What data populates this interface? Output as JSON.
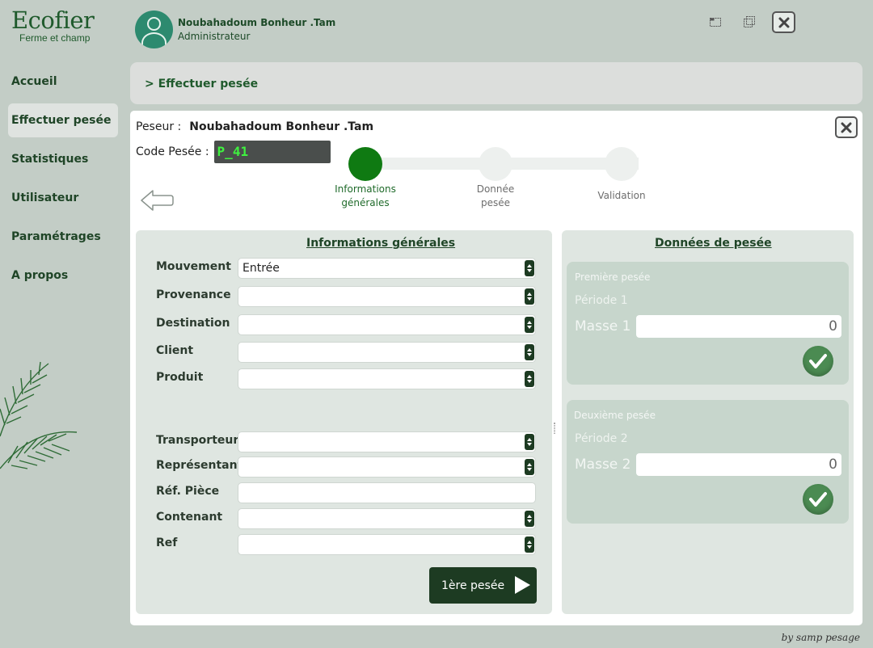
{
  "app": {
    "title": "Ecofier",
    "subtitle": "Ferme et champ"
  },
  "user": {
    "name": "Noubahadoum Bonheur .Tam",
    "role": "Administrateur"
  },
  "sidebar": {
    "items": [
      {
        "label": "Accueil"
      },
      {
        "label": "Effectuer pesée"
      },
      {
        "label": "Statistiques"
      },
      {
        "label": "Utilisateur"
      },
      {
        "label": "Paramétrages"
      },
      {
        "label": "A propos"
      }
    ]
  },
  "breadcrumb": "> Effectuer pesée",
  "session": {
    "peseur_label": "Peseur :",
    "peseur_name": "Noubahadoum Bonheur .Tam",
    "code_label": "Code Pesée :",
    "code_value": "P_41"
  },
  "stepper": {
    "steps": [
      {
        "label": "Informations générales",
        "state": "done"
      },
      {
        "label": "Donnée pesée",
        "state": "pending"
      },
      {
        "label": "Validation",
        "state": "pending"
      }
    ]
  },
  "form": {
    "title": "Informations générales",
    "fields": [
      {
        "label": "Mouvement",
        "value": "Entrée",
        "type": "select"
      },
      {
        "label": "Provenance",
        "value": "",
        "type": "select"
      },
      {
        "label": "Destination",
        "value": "",
        "type": "select"
      },
      {
        "label": "Client",
        "value": "",
        "type": "select"
      },
      {
        "label": "Produit",
        "value": "",
        "type": "select"
      },
      {
        "label": "Transporteur",
        "value": "",
        "type": "select"
      },
      {
        "label": "Représentant",
        "value": "",
        "type": "select"
      },
      {
        "label": "Réf. Pièce",
        "value": "",
        "type": "text"
      },
      {
        "label": "Contenant",
        "value": "",
        "type": "select"
      },
      {
        "label": "Ref",
        "value": "",
        "type": "select"
      }
    ],
    "next_button": "1ère pesée"
  },
  "weighing": {
    "title": "Données de pesée",
    "first": {
      "title": "Première pesée",
      "period": "Période 1",
      "masse_label": "Masse 1",
      "masse_value": "0"
    },
    "second": {
      "title": "Deuxième pesée",
      "period": "Période 2",
      "masse_label": "Masse 2",
      "masse_value": "0"
    }
  },
  "footer": "by samp pesage",
  "colors": {
    "brand": "#1f5a2c",
    "accent_dark": "#1d3b22",
    "step_done": "#0f7a12",
    "code_text": "#3ff23f"
  }
}
